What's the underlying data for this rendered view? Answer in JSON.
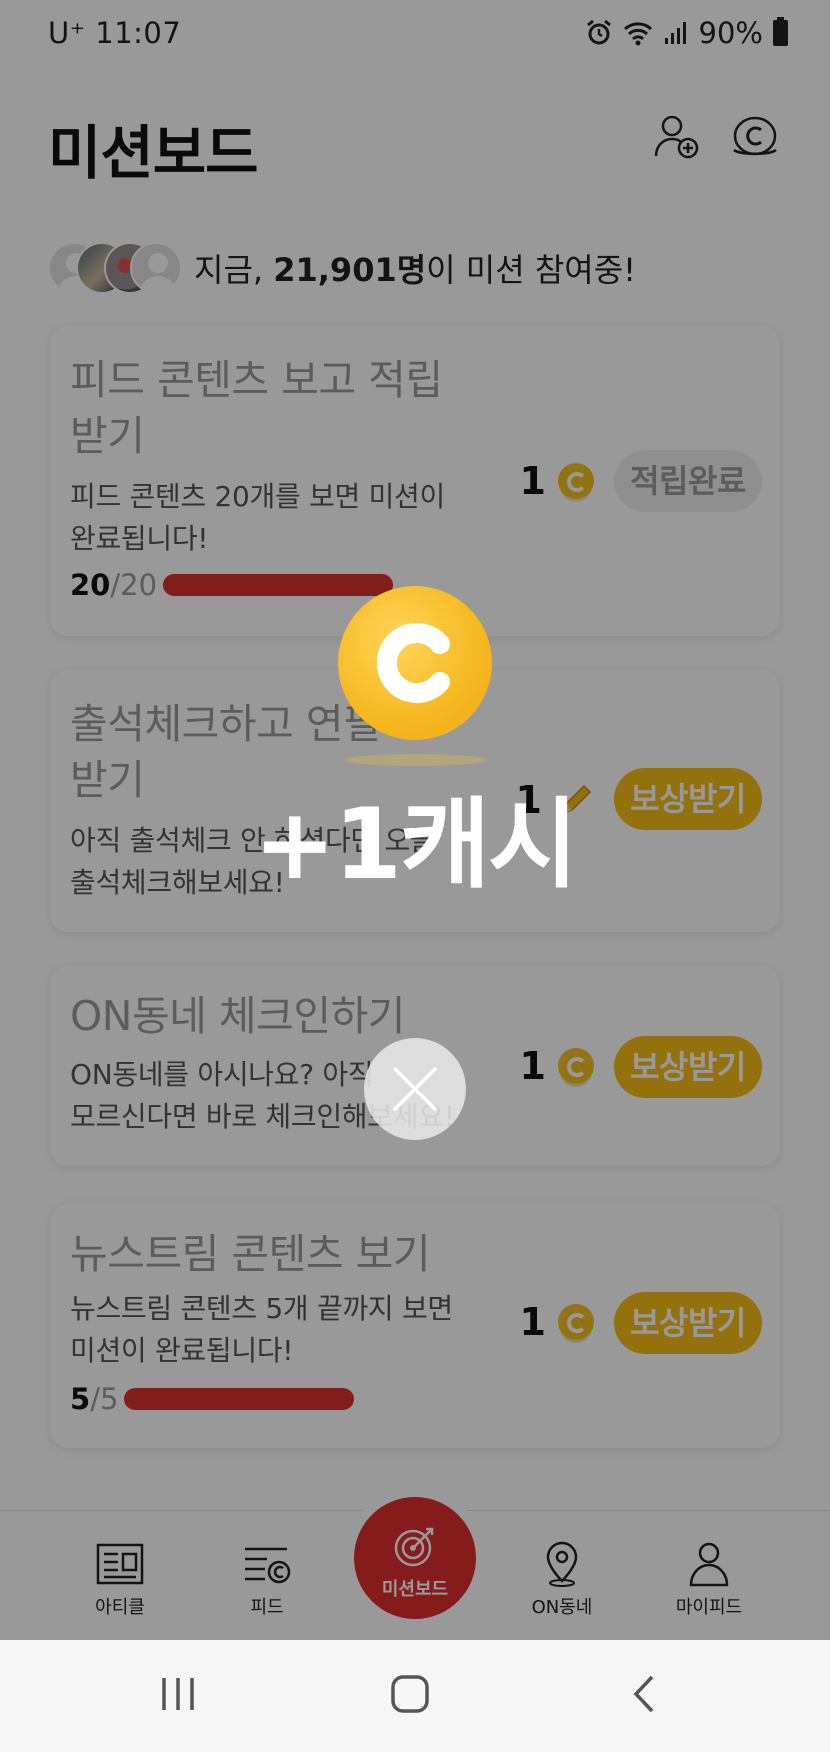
{
  "status_bar": {
    "carrier_time": "U⁺ 11:07",
    "battery": "90%"
  },
  "header": {
    "title": "미션보드"
  },
  "participation": {
    "prefix": "지금, ",
    "count": "21,901명",
    "suffix": "이 미션 참여중!"
  },
  "missions": [
    {
      "title": "피드 콘텐츠 보고 적립\n받기",
      "desc": "피드 콘텐츠 20개를 보면 미션이\n완료됩니다!",
      "progress_current": "20",
      "progress_total": "/20",
      "progress_fraction": 1.0,
      "reward": "1",
      "reward_icon": "coin-icon",
      "button": "적립완료",
      "button_state": "done"
    },
    {
      "title": "출석체크하고 연필\n받기",
      "desc": "아직 출석체크 안 하셨다면 오늘\n출석체크해보세요!",
      "reward": "1",
      "reward_icon": "pencil-icon",
      "button": "보상받기",
      "button_state": "claim"
    },
    {
      "title": "ON동네 체크인하기",
      "desc": "ON동네를 아시나요? 아직\n모르신다면 바로 체크인해보세요!",
      "reward": "1",
      "reward_icon": "coin-icon",
      "button": "보상받기",
      "button_state": "claim"
    },
    {
      "title": "뉴스트림 콘텐츠 보기",
      "desc": "뉴스트림 콘텐츠 5개 끝까지 보면\n미션이 완료됩니다!",
      "progress_current": "5",
      "progress_total": "/5",
      "progress_fraction": 1.0,
      "reward": "1",
      "reward_icon": "coin-icon",
      "button": "보상받기",
      "button_state": "claim"
    }
  ],
  "bottom_nav": [
    {
      "label": "아티클",
      "icon": "article-icon"
    },
    {
      "label": "피드",
      "icon": "feed-icon"
    },
    {
      "label": "미션보드",
      "icon": "target-icon",
      "active": true
    },
    {
      "label": "ON동네",
      "icon": "location-pin-icon"
    },
    {
      "label": "마이피드",
      "icon": "person-icon"
    }
  ],
  "overlay": {
    "reward_text": "+1캐시"
  },
  "colors": {
    "accent_red": "#e02d2d",
    "coin_yellow": "#f5bd14",
    "progress_red": "#d8332e"
  }
}
